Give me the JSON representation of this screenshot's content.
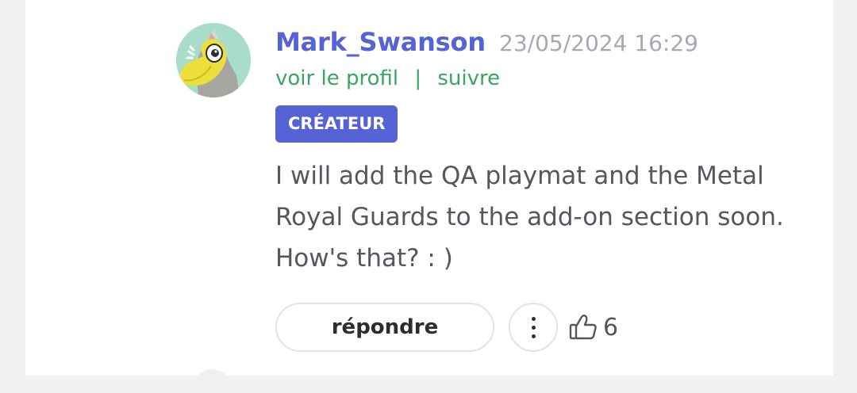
{
  "comment": {
    "username": "Mark_Swanson",
    "timestamp": "23/05/2024 16:29",
    "links": {
      "view_profile": "voir le profil",
      "separator": "|",
      "follow": "suivre"
    },
    "badge": "CRÉATEUR",
    "message": "I will add the QA playmat and the Metal Royal Guards to the add-on section soon. How's that?  : )",
    "actions": {
      "reply_label": "répondre",
      "more_icon": "vertical-ellipsis-icon",
      "like_icon": "thumbs-up-icon",
      "like_count": "6"
    },
    "avatar_icon": "yellow-bird-avatar"
  },
  "colors": {
    "username": "#5563d6",
    "badge_bg": "#5563d6",
    "link_green": "#3aa660",
    "timestamp_gray": "#a7a8b3",
    "body_text": "#55565f",
    "page_bg": "#f1f1f3"
  }
}
